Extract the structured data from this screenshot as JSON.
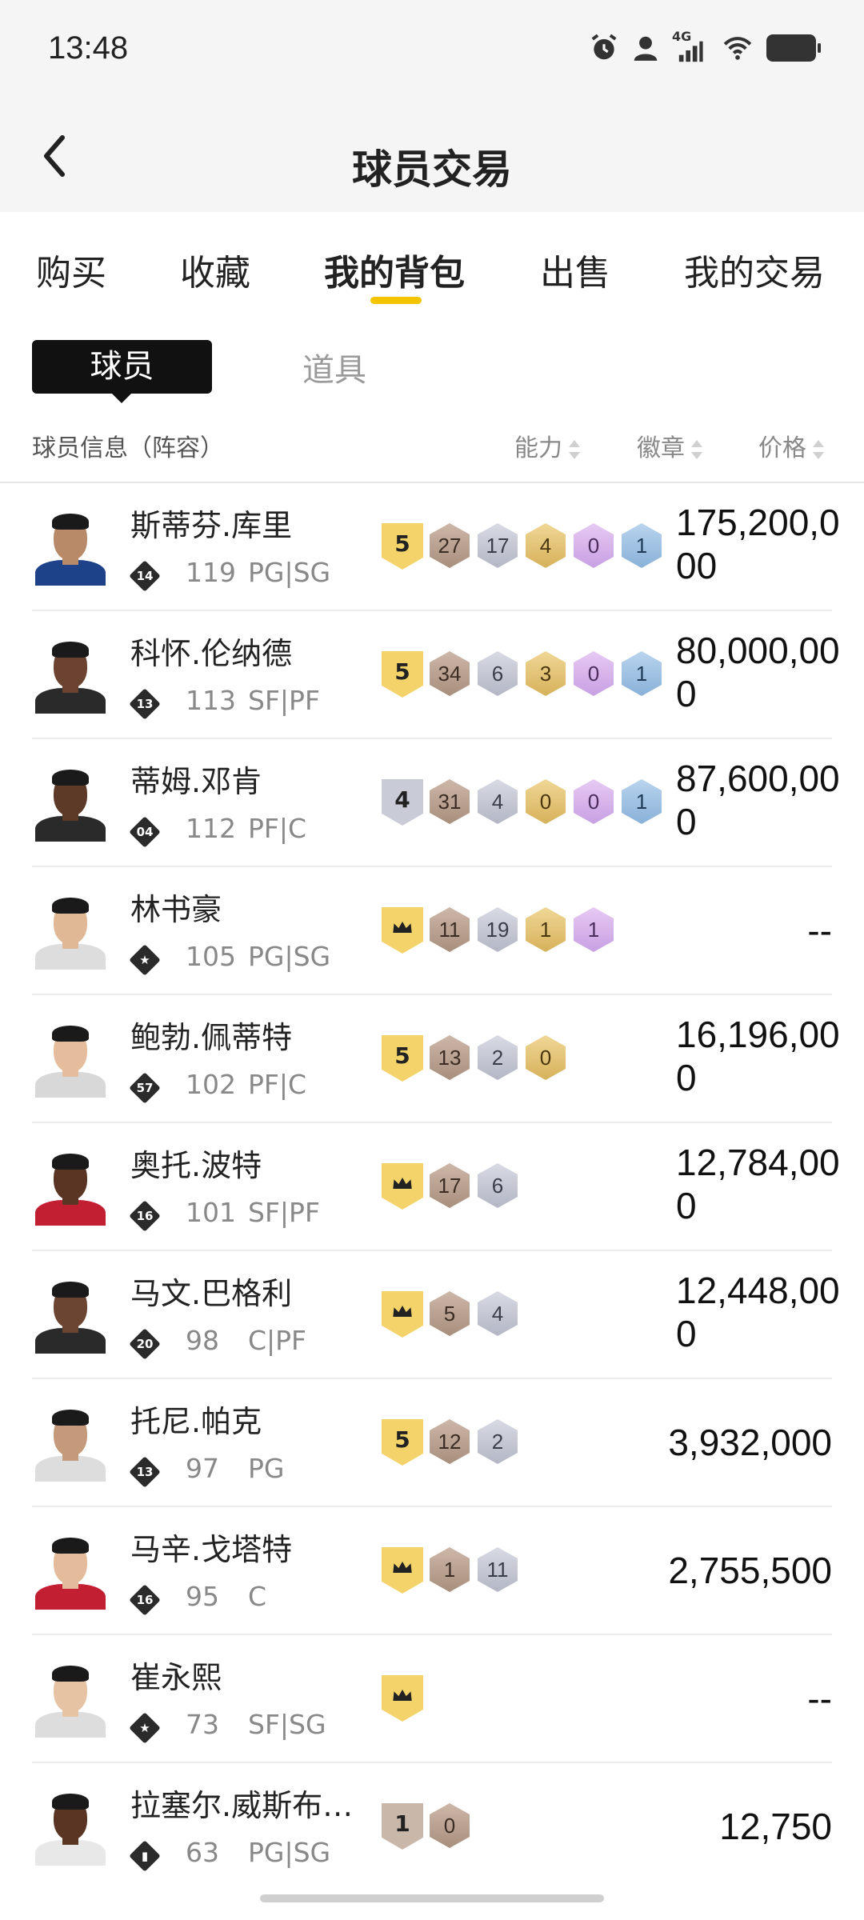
{
  "status_bar": {
    "time": "13:48",
    "network": "4G"
  },
  "header": {
    "title": "球员交易"
  },
  "tabs": [
    {
      "label": "购买"
    },
    {
      "label": "收藏"
    },
    {
      "label": "我的背包"
    },
    {
      "label": "出售"
    },
    {
      "label": "我的交易"
    }
  ],
  "active_tab": "我的背包",
  "sub_tabs": [
    {
      "label": "球员"
    },
    {
      "label": "道具"
    }
  ],
  "columns": {
    "info": "球员信息（阵容）",
    "ability": "能力",
    "badge": "徽章",
    "price": "价格"
  },
  "colors": {
    "accent": "#f5c400",
    "gold_level": "#f3d36a",
    "silver_level": "#c9cbd6",
    "bronze_level": "#c9b7aa"
  },
  "players": [
    {
      "name": "斯蒂芬.库里",
      "tier": "14",
      "rating": "119",
      "position": "PG|SG",
      "level": "5",
      "badges": [
        "27",
        "17",
        "4",
        "0",
        "1"
      ],
      "price": "175,200,000",
      "skin": "#b88a68",
      "jersey": "#1d428a"
    },
    {
      "name": "科怀.伦纳德",
      "tier": "13",
      "rating": "113",
      "position": "SF|PF",
      "level": "5",
      "badges": [
        "34",
        "6",
        "3",
        "0",
        "1"
      ],
      "price": "80,000,000",
      "skin": "#6b4330",
      "jersey": "#2a2a2a"
    },
    {
      "name": "蒂姆.邓肯",
      "tier": "04",
      "rating": "112",
      "position": "PF|C",
      "level": "4",
      "badges": [
        "31",
        "4",
        "0",
        "0",
        "1"
      ],
      "price": "87,600,000",
      "skin": "#5d3a28",
      "jersey": "#2a2a2a"
    },
    {
      "name": "林书豪",
      "tier": "★",
      "rating": "105",
      "position": "PG|SG",
      "level": "crown",
      "badges": [
        "11",
        "19",
        "1",
        "1"
      ],
      "price": "--",
      "skin": "#e0b896",
      "jersey": "#dddddd"
    },
    {
      "name": "鲍勃.佩蒂特",
      "tier": "57",
      "rating": "102",
      "position": "PF|C",
      "level": "5",
      "badges": [
        "13",
        "2",
        "0"
      ],
      "price": "16,196,000",
      "skin": "#e5bd9c",
      "jersey": "#d8d8d8"
    },
    {
      "name": "奥托.波特",
      "tier": "16",
      "rating": "101",
      "position": "SF|PF",
      "level": "crown",
      "badges": [
        "17",
        "6"
      ],
      "price": "12,784,000",
      "skin": "#5a3524",
      "jersey": "#c21f32"
    },
    {
      "name": "马文.巴格利",
      "tier": "20",
      "rating": "98",
      "position": "C|PF",
      "level": "crown",
      "badges": [
        "5",
        "4"
      ],
      "price": "12,448,000",
      "skin": "#6b4432",
      "jersey": "#2a2a2a"
    },
    {
      "name": "托尼.帕克",
      "tier": "13",
      "rating": "97",
      "position": "PG",
      "level": "5",
      "badges": [
        "12",
        "2"
      ],
      "price": "3,932,000",
      "skin": "#c49a7a",
      "jersey": "#dddddd"
    },
    {
      "name": "马辛.戈塔特",
      "tier": "16",
      "rating": "95",
      "position": "C",
      "level": "crown",
      "badges": [
        "1",
        "11"
      ],
      "price": "2,755,500",
      "skin": "#e4bc9c",
      "jersey": "#c21f32"
    },
    {
      "name": "崔永熙",
      "tier": "★",
      "rating": "73",
      "position": "SF|SG",
      "level": "crown",
      "badges": [],
      "price": "--",
      "skin": "#e6c3a3",
      "jersey": "#dddddd"
    },
    {
      "name": "拉塞尔.威斯布…",
      "tier": "▮",
      "rating": "63",
      "position": "PG|SG",
      "level": "1",
      "badges": [
        "0"
      ],
      "price": "12,750",
      "skin": "#5a3524",
      "jersey": "#e8e8e8"
    }
  ]
}
